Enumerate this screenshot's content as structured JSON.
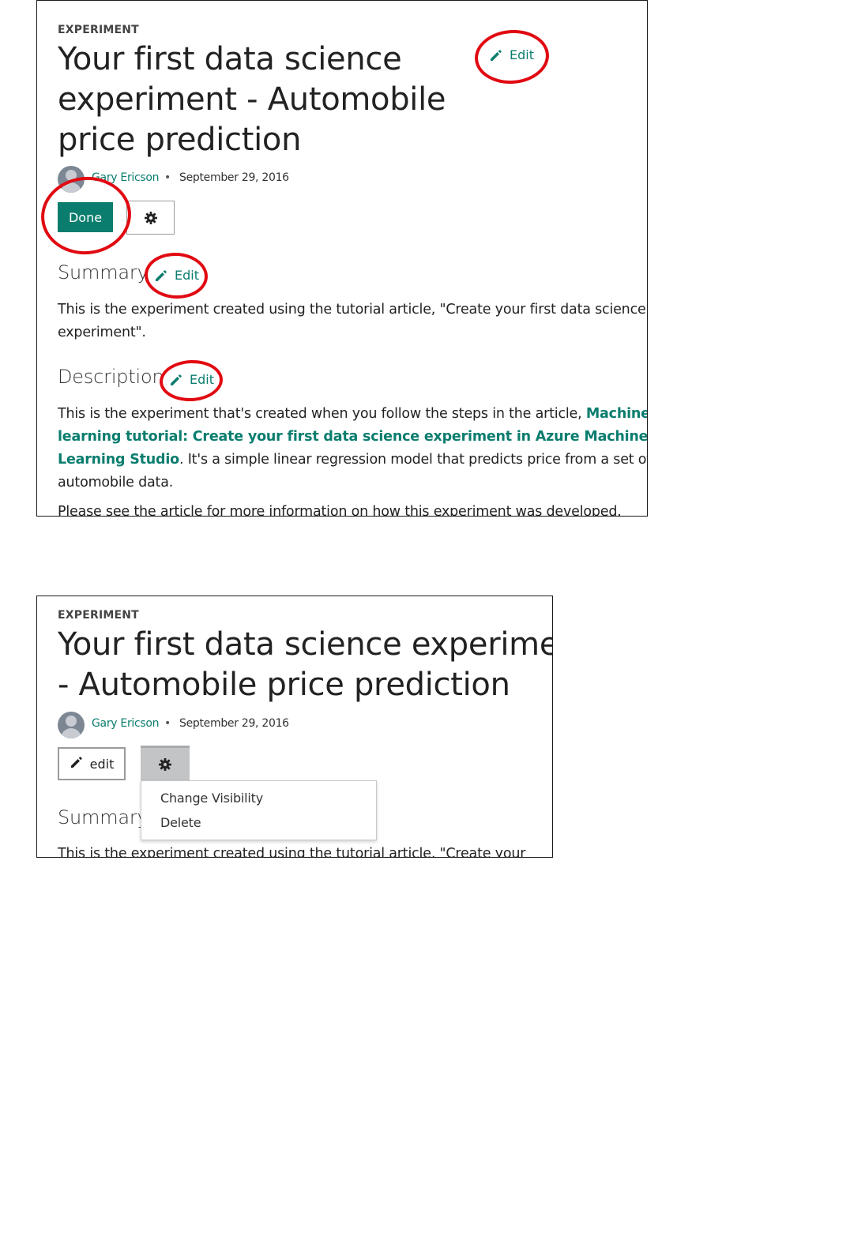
{
  "panel1": {
    "eyebrow": "EXPERIMENT",
    "title_lines": [
      "Your first data science",
      "experiment - Automobile",
      "price prediction"
    ],
    "title_edit_label": "Edit",
    "author": "Gary Ericson",
    "separator": "•",
    "date": "September 29, 2016",
    "done_label": "Done",
    "summary": {
      "heading": "Summary",
      "edit_label": "Edit",
      "text_lines": [
        "This is the experiment created using the tutorial article, \"Create your first data science",
        "experiment\"."
      ]
    },
    "description": {
      "heading": "Description",
      "edit_label": "Edit",
      "line1_text": "This is the experiment that's created when you follow the steps in the article, ",
      "link_line1": "Machine",
      "link_line2": "learning tutorial: Create your first data science experiment in Azure Machine",
      "link_line3": "Learning Studio",
      "line3_rest": ". It's a simple linear regression model that predicts price from a set of",
      "line4": "automobile data.",
      "line5": "Please see the article for more information on how this experiment was developed."
    }
  },
  "panel2": {
    "eyebrow": "EXPERIMENT",
    "title_lines": [
      "Your first data science experiment",
      "- Automobile price prediction"
    ],
    "author": "Gary Ericson",
    "separator": "•",
    "date": "September 29, 2016",
    "edit_label": "edit",
    "menu": [
      "Change Visibility",
      "Delete"
    ],
    "summary_heading": "Summary",
    "summary_partial": "This is the experiment created using the tutorial article, \"Create your first data science"
  },
  "colors": {
    "accent": "#0a7d6e",
    "annotation": "#e10a12"
  },
  "icons": [
    "pencil-icon",
    "gear-icon",
    "avatar-icon"
  ]
}
